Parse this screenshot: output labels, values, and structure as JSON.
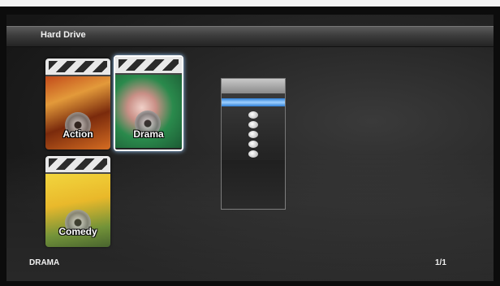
{
  "header": {
    "title": "Hard Drive"
  },
  "folders": [
    {
      "label": "Action",
      "selected": false
    },
    {
      "label": "Drama",
      "selected": true
    },
    {
      "label": "Comedy",
      "selected": false
    }
  ],
  "footer": {
    "selected_name": "DRAMA",
    "page": "1/1"
  },
  "colors": {
    "highlight": "#9fd0ff",
    "background": "#1a1a1a"
  },
  "icons": [
    "clapperboard-icon",
    "disc-icon",
    "scroll-indicator-icon"
  ]
}
